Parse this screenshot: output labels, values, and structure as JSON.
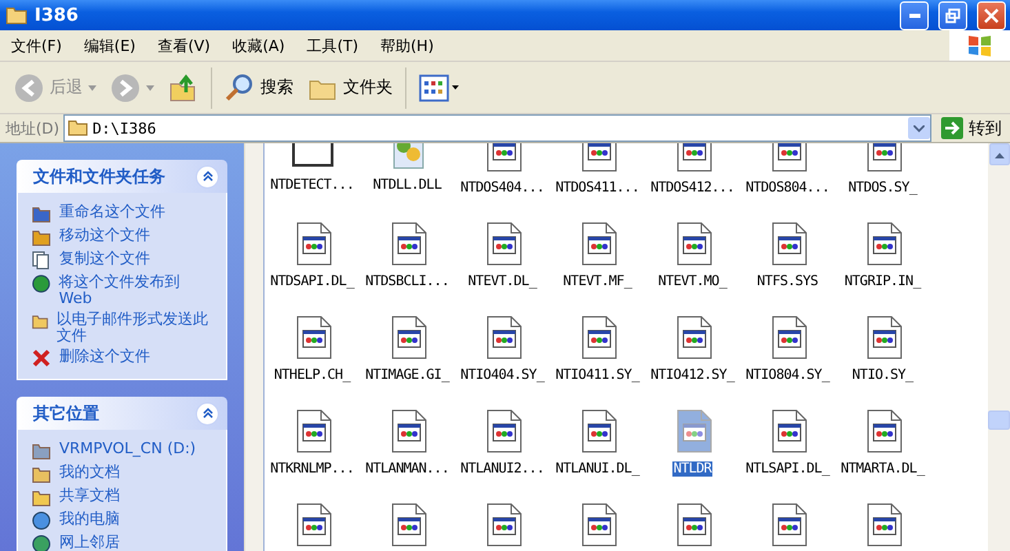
{
  "window": {
    "title": "I386"
  },
  "menu": [
    {
      "label": "文件(F)"
    },
    {
      "label": "编辑(E)"
    },
    {
      "label": "查看(V)"
    },
    {
      "label": "收藏(A)"
    },
    {
      "label": "工具(T)"
    },
    {
      "label": "帮助(H)"
    }
  ],
  "toolbar": [
    {
      "kind": "back",
      "label": "后退",
      "disabled": true
    },
    {
      "kind": "forward",
      "disabled": true
    },
    {
      "kind": "up"
    },
    {
      "kind": "search",
      "label": "搜索"
    },
    {
      "kind": "folders",
      "label": "文件夹"
    },
    {
      "kind": "views"
    }
  ],
  "address": {
    "label": "地址(D)",
    "value": "D:\\I386",
    "go": "转到"
  },
  "panels": [
    {
      "title": "文件和文件夹任务",
      "expanded": true,
      "items": [
        {
          "kind": "rename",
          "label": "重命名这个文件"
        },
        {
          "kind": "move",
          "label": "移动这个文件"
        },
        {
          "kind": "copy",
          "label": "复制这个文件"
        },
        {
          "kind": "web",
          "label": "将这个文件发布到 Web"
        },
        {
          "kind": "mail",
          "label": "以电子邮件形式发送此文件"
        },
        {
          "kind": "delete",
          "label": "删除这个文件"
        }
      ]
    },
    {
      "title": "其它位置",
      "expanded": true,
      "items": [
        {
          "kind": "drive",
          "label": "VRMPVOL_CN (D:)"
        },
        {
          "kind": "docs",
          "label": "我的文档"
        },
        {
          "kind": "shared",
          "label": "共享文档"
        },
        {
          "kind": "computer",
          "label": "我的电脑"
        },
        {
          "kind": "network",
          "label": "网上邻居"
        }
      ]
    }
  ],
  "files": [
    {
      "kind": "window",
      "name": "NTDETECT...",
      "selected": false
    },
    {
      "kind": "dll",
      "name": "NTDLL.DLL",
      "selected": false
    },
    {
      "kind": "file",
      "name": "NTDOS404...",
      "selected": false
    },
    {
      "kind": "file",
      "name": "NTDOS411...",
      "selected": false
    },
    {
      "kind": "file",
      "name": "NTDOS412...",
      "selected": false
    },
    {
      "kind": "file",
      "name": "NTDOS804...",
      "selected": false
    },
    {
      "kind": "file",
      "name": "NTDOS.SY_",
      "selected": false
    },
    {
      "kind": "file",
      "name": "NTDSAPI.DL_",
      "selected": false
    },
    {
      "kind": "file",
      "name": "NTDSBCLI...",
      "selected": false
    },
    {
      "kind": "file",
      "name": "NTEVT.DL_",
      "selected": false
    },
    {
      "kind": "file",
      "name": "NTEVT.MF_",
      "selected": false
    },
    {
      "kind": "file",
      "name": "NTEVT.MO_",
      "selected": false
    },
    {
      "kind": "file",
      "name": "NTFS.SYS",
      "selected": false
    },
    {
      "kind": "file",
      "name": "NTGRIP.IN_",
      "selected": false
    },
    {
      "kind": "file",
      "name": "NTHELP.CH_",
      "selected": false
    },
    {
      "kind": "file",
      "name": "NTIMAGE.GI_",
      "selected": false
    },
    {
      "kind": "file",
      "name": "NTIO404.SY_",
      "selected": false
    },
    {
      "kind": "file",
      "name": "NTIO411.SY_",
      "selected": false
    },
    {
      "kind": "file",
      "name": "NTIO412.SY_",
      "selected": false
    },
    {
      "kind": "file",
      "name": "NTIO804.SY_",
      "selected": false
    },
    {
      "kind": "file",
      "name": "NTIO.SY_",
      "selected": false
    },
    {
      "kind": "file",
      "name": "NTKRNLMP...",
      "selected": false
    },
    {
      "kind": "file",
      "name": "NTLANMAN...",
      "selected": false
    },
    {
      "kind": "file",
      "name": "NTLANUI2...",
      "selected": false
    },
    {
      "kind": "file",
      "name": "NTLANUI.DL_",
      "selected": false
    },
    {
      "kind": "file",
      "name": "NTLDR",
      "selected": true
    },
    {
      "kind": "file",
      "name": "NTLSAPI.DL_",
      "selected": false
    },
    {
      "kind": "file",
      "name": "NTMARTA.DL_",
      "selected": false
    }
  ]
}
